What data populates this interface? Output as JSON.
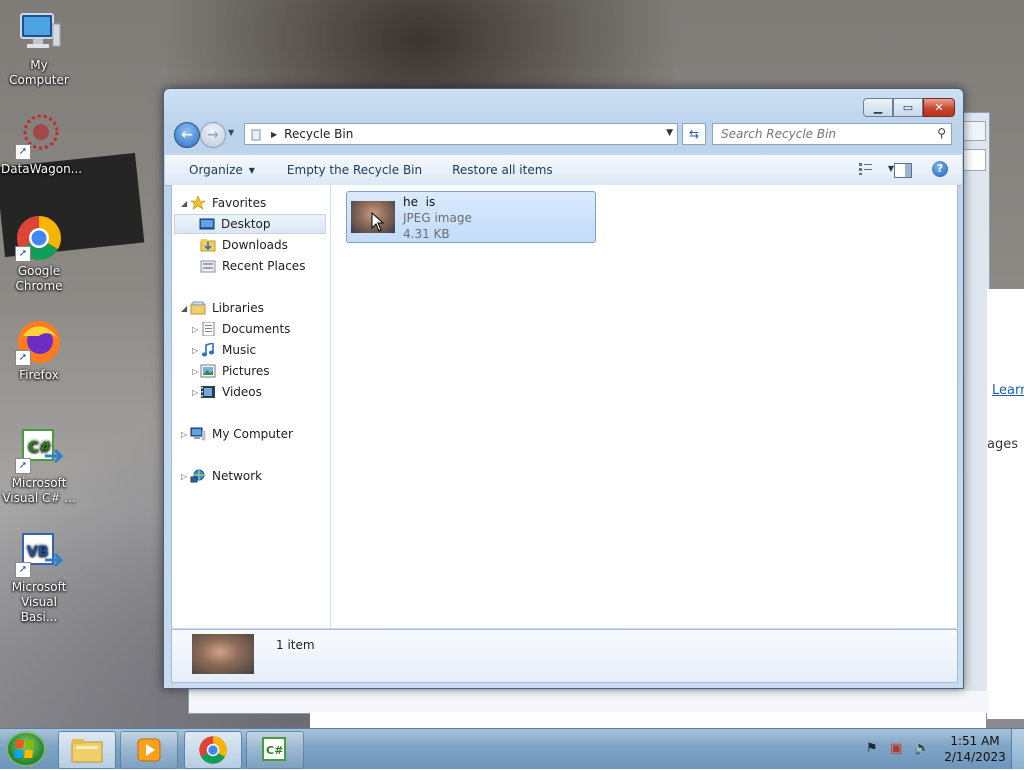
{
  "desktop": {
    "icons": [
      {
        "label": "My Computer",
        "icon": "computer-icon"
      },
      {
        "label": "DataWagon...",
        "icon": "datawagon-icon"
      },
      {
        "label": "Google Chrome",
        "icon": "chrome-icon"
      },
      {
        "label": "Firefox",
        "icon": "firefox-icon"
      },
      {
        "label": "Microsoft Visual C# ...",
        "icon": "visual-csharp-icon"
      },
      {
        "label": "Microsoft Visual Basi...",
        "icon": "visual-basic-icon"
      }
    ]
  },
  "background_window": {
    "learn_text": "Learn",
    "images_text": "ages"
  },
  "window": {
    "address": {
      "location": "Recycle Bin"
    },
    "search": {
      "placeholder": "Search Recycle Bin"
    },
    "toolbar": {
      "organize": "Organize",
      "empty": "Empty the Recycle Bin",
      "restore": "Restore all items"
    },
    "nav": {
      "favorites": "Favorites",
      "desktop": "Desktop",
      "downloads": "Downloads",
      "recent": "Recent Places",
      "libraries": "Libraries",
      "documents": "Documents",
      "music": "Music",
      "pictures": "Pictures",
      "videos": "Videos",
      "computer": "My Computer",
      "network": "Network"
    },
    "file": {
      "name": "he  is",
      "type": "JPEG image",
      "size": "4.31 KB"
    },
    "details": {
      "count": "1 item"
    }
  },
  "taskbar": {
    "time": "1:51 AM",
    "date": "2/14/2023"
  },
  "colors": {
    "accent": "#2a6ec4",
    "selection": "#c1dcfa",
    "taskbar": "#7ea3c4"
  }
}
